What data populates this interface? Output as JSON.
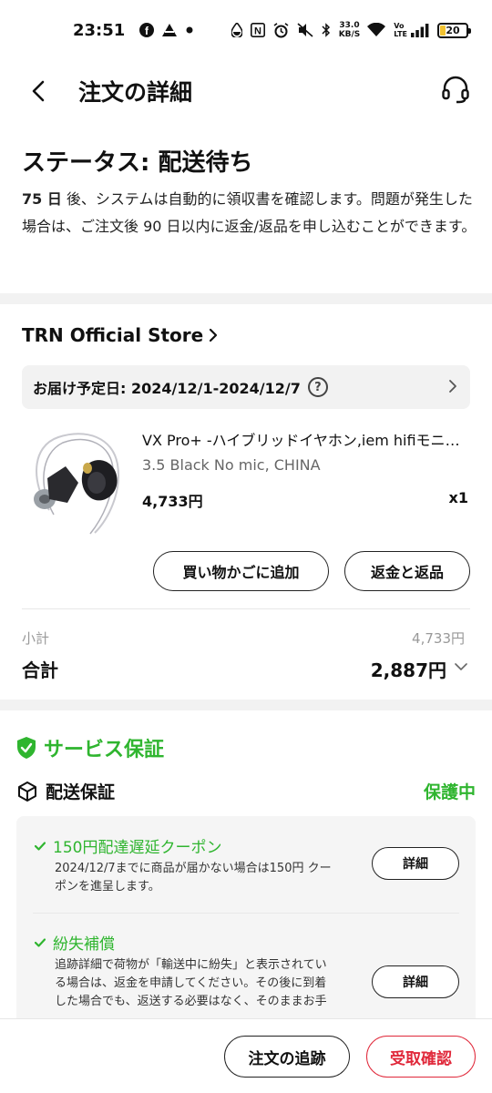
{
  "status_bar": {
    "time": "23:51",
    "net_speed_value": "33.0",
    "net_speed_unit": "KB/S",
    "volte": "Vo\nLTE",
    "battery": "20",
    "icons": [
      "facebook-icon",
      "app-icon",
      "dot-icon",
      "drop-icon",
      "nfc-icon",
      "alarm-icon",
      "mute-icon",
      "bluetooth-icon",
      "wifi-icon",
      "signal-icon"
    ]
  },
  "header": {
    "title": "注文の詳細"
  },
  "status": {
    "title": "ステータス: 配送待ち",
    "days": "75 日",
    "desc_rest": " 後、システムは自動的に領収書を確認します。問題が発生した場合は、ご注文後 90 日以内に返金/返品を申し込むことができます。"
  },
  "store": {
    "name": "TRN Official Store",
    "delivery_label": "お届け予定日: 2024/12/1-2024/12/7"
  },
  "product": {
    "name": "VX Pro+ -ハイブリッドイヤホン,iem hifiモニター",
    "variant": "3.5 Black No mic, CHINA",
    "price": "4,733円",
    "qty": "x1",
    "add_cart_label": "買い物かごに追加",
    "refund_label": "返金と返品"
  },
  "totals": {
    "subtotal_label": "小計",
    "subtotal_value": "4,733円",
    "total_label": "合計",
    "total_value": "2,887円"
  },
  "service": {
    "title": "サービス保証",
    "shipping_label": "配送保証",
    "protected_label": "保護中",
    "items": [
      {
        "title": "150円配達遅延クーポン",
        "desc_line1": "2024/12/7までに商品が届かない場合は150円 クー",
        "desc_line2": "ポンを進呈します。",
        "button": "詳細"
      },
      {
        "title": "紛失補償",
        "desc_line1": "追跡詳細で荷物が「輸送中に紛失」と表示されてい",
        "desc_line2": "る場合は、返金を申請してください。その後に到着",
        "desc_line3": "した場合でも、返送する必要はなく、そのままお手",
        "button": "詳細"
      }
    ]
  },
  "bottom": {
    "track_label": "注文の追跡",
    "confirm_label": "受取確認"
  },
  "colors": {
    "accent_green": "#2fb52f",
    "accent_red": "#e0283a",
    "divider_gray": "#f2f2f2"
  }
}
